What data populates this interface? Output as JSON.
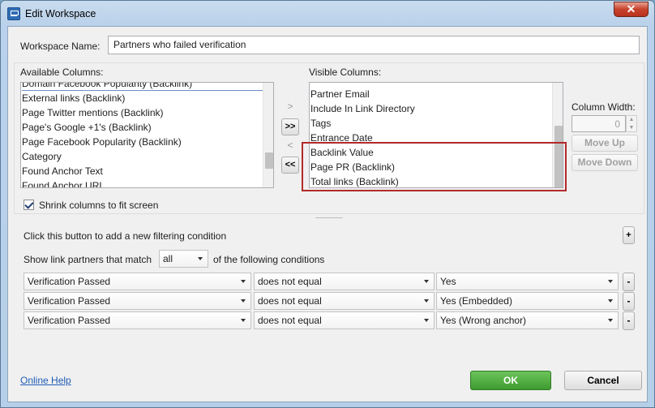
{
  "window": {
    "title": "Edit Workspace",
    "close_glyph": "✕"
  },
  "workspace": {
    "name_label": "Workspace Name:",
    "name_value": "Partners who failed verification"
  },
  "available": {
    "label": "Available Columns:",
    "items": [
      "Domain Facebook Popularity (Backlink)",
      "External links (Backlink)",
      "Page Twitter mentions (Backlink)",
      "Page's Google +1's (Backlink)",
      "Page Facebook Popularity (Backlink)",
      "Category",
      "Found Anchor Text",
      "Found Anchor URL"
    ]
  },
  "visible": {
    "label": "Visible Columns:",
    "items": [
      "Partner Email",
      "Include In Link Directory",
      "Tags",
      "Entrance Date",
      "Backlink Value",
      "Page PR (Backlink)",
      "Total links (Backlink)"
    ]
  },
  "transfer": {
    "add": ">",
    "add_all": ">>",
    "remove": "<",
    "remove_all": "<<"
  },
  "column_width": {
    "label": "Column Width:",
    "value": "0"
  },
  "move": {
    "up": "Move Up",
    "down": "Move Down"
  },
  "shrink": {
    "label": "Shrink columns to fit screen",
    "checked": true
  },
  "filter": {
    "hint": "Click this button to add a new filtering condition",
    "add": "+",
    "show_prefix": "Show link partners that match",
    "match_value": "all",
    "show_suffix": "of the following conditions",
    "conditions": [
      {
        "field": "Verification Passed",
        "op": "does not equal",
        "value": "Yes",
        "remove": "-"
      },
      {
        "field": "Verification Passed",
        "op": "does not equal",
        "value": "Yes (Embedded)",
        "remove": "-"
      },
      {
        "field": "Verification Passed",
        "op": "does not equal",
        "value": "Yes (Wrong anchor)",
        "remove": "-"
      }
    ]
  },
  "footer": {
    "help": "Online Help",
    "ok": "OK",
    "cancel": "Cancel"
  },
  "colors": {
    "ok_green": "#4aa53a",
    "highlight_red": "#b22a2a"
  }
}
